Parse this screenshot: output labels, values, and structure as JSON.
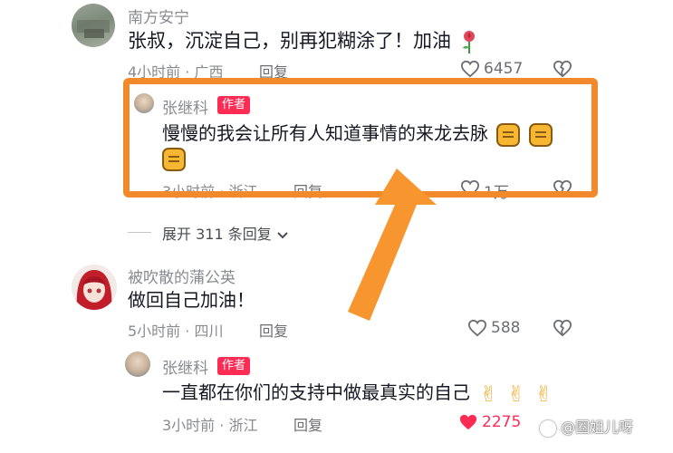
{
  "comments": [
    {
      "username": "南方安宁",
      "text": "张叔，沉淀自己，别再犯糊涂了！加油",
      "emoji": "rose-emoji",
      "time_location": "4小时前 · 广西",
      "reply_label": "回复",
      "likes": "6457"
    },
    {
      "username": "张继科",
      "badge": "作者",
      "text": "慢慢的我会让所有人知道事情的来龙去脉",
      "emoji": "fist-emoji",
      "time_location": "3小时前 · 浙江",
      "reply_label": "回复",
      "likes": "1万"
    },
    {
      "expand_label": "展开 311 条回复"
    },
    {
      "username": "被吹散的蒲公英",
      "text": "做回自己加油！",
      "time_location": "5小时前 · 四川",
      "reply_label": "回复",
      "likes": "588"
    },
    {
      "username": "张继科",
      "badge": "作者",
      "text": "一直都在你们的支持中做最真实的自己",
      "emoji": "victory-hand-emoji",
      "time_location": "3小时前 · 浙江",
      "reply_label": "回复",
      "likes": "2275"
    }
  ],
  "watermark": "@圈姐儿呀",
  "colors": {
    "liked_heart": "#fe2c55",
    "badge": "#fe2c55",
    "highlight_annotation": "#f28a2c",
    "meta_text": "#8a8b91"
  }
}
